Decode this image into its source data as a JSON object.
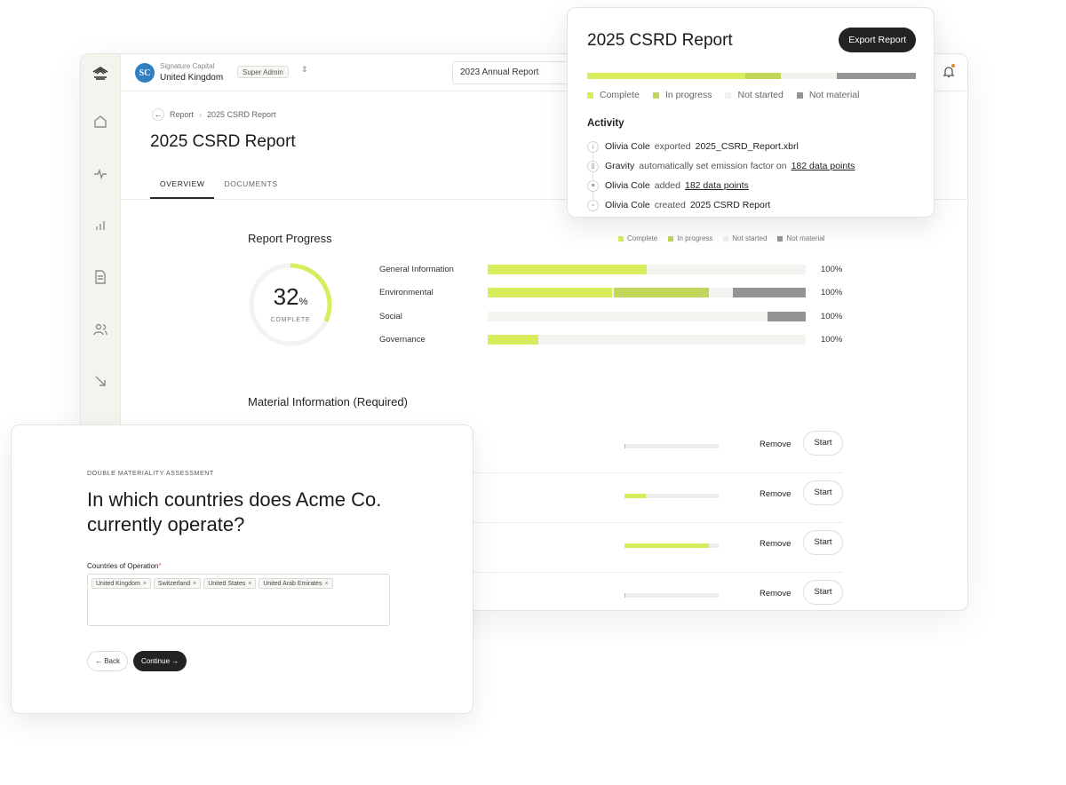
{
  "colors": {
    "complete": "#d8ec5c",
    "in_progress": "#c2d65a",
    "not_started": "#f1f1ee",
    "not_material": "#949494",
    "accent_dark": "#232323",
    "org_avatar": "#2f7fc1"
  },
  "sidebar": {
    "icons": [
      "logo-icon",
      "home-icon",
      "activity-icon",
      "bar-chart-icon",
      "document-icon",
      "users-icon",
      "arrow-down-right-icon"
    ]
  },
  "topbar": {
    "org_avatar": "SC",
    "org_name": "Signature Capital",
    "org_country": "United Kingdom",
    "role": "Super Admin",
    "report_select": "2023 Annual Report"
  },
  "breadcrumb": {
    "root": "Report",
    "current": "2025 CSRD Report"
  },
  "page": {
    "title": "2025 CSRD Report"
  },
  "tabs": [
    {
      "label": "OVERVIEW"
    },
    {
      "label": "DOCUMENTS"
    }
  ],
  "report_progress": {
    "title": "Report Progress",
    "percent": "32",
    "percent_unit": "%",
    "percent_value": 0.32,
    "sub": "COMPLETE",
    "legend": [
      "Complete",
      "In progress",
      "Not started",
      "Not material"
    ],
    "rows": [
      {
        "label": "General Information",
        "pct": "100%",
        "complete": 0.5,
        "in_progress": 0,
        "not_material": 0
      },
      {
        "label": "Environmental",
        "pct": "100%",
        "complete": 0.39,
        "in_progress": 0.3,
        "not_material": 0.23
      },
      {
        "label": "Social",
        "pct": "100%",
        "complete": 0,
        "in_progress": 0,
        "not_material": 0.12
      },
      {
        "label": "Governance",
        "pct": "100%",
        "complete": 0.16,
        "in_progress": 0,
        "not_material": 0
      }
    ]
  },
  "material_info": {
    "title": "Material Information (Required)",
    "remove_label": "Remove",
    "start_label": "Start",
    "rows": [
      {
        "progress": 0.01
      },
      {
        "progress": 0.23
      },
      {
        "progress": 0.9
      },
      {
        "progress": 0.01
      }
    ]
  },
  "report_card": {
    "title": "2025 CSRD Report",
    "export_label": "Export Report",
    "bar": {
      "complete": 0.48,
      "in_progress": 0.11,
      "not_started": 0.17,
      "not_material": 0.24
    },
    "legend": [
      "Complete",
      "In progress",
      "Not started",
      "Not material"
    ],
    "activity_title": "Activity",
    "activity": [
      {
        "icon": "download-icon",
        "who": "Olivia Cole",
        "verb": "exported",
        "object": "2025_CSRD_Report.xbrl",
        "link": false
      },
      {
        "icon": "book-icon",
        "who": "Gravity",
        "verb": "automatically set emission factor on",
        "object": "182 data points",
        "link": true
      },
      {
        "icon": "list-icon",
        "who": "Olivia Cole",
        "verb": "added",
        "object": "182 data points",
        "link": true
      },
      {
        "icon": "file-icon",
        "who": "Olivia Cole",
        "verb": "created",
        "object": "2025  CSRD Report",
        "link": false
      }
    ]
  },
  "dma": {
    "kicker": "DOUBLE MATERIALITY ASSESSMENT",
    "question": "In which countries does Acme Co. currently operate?",
    "field_label": "Countries of Operation",
    "required_mark": "*",
    "chips": [
      "United Kingdom",
      "Switzerland",
      "United States",
      "United Arab Emirates"
    ],
    "chip_remove": "×",
    "back_label": "← Back",
    "continue_label": "Continue →"
  }
}
